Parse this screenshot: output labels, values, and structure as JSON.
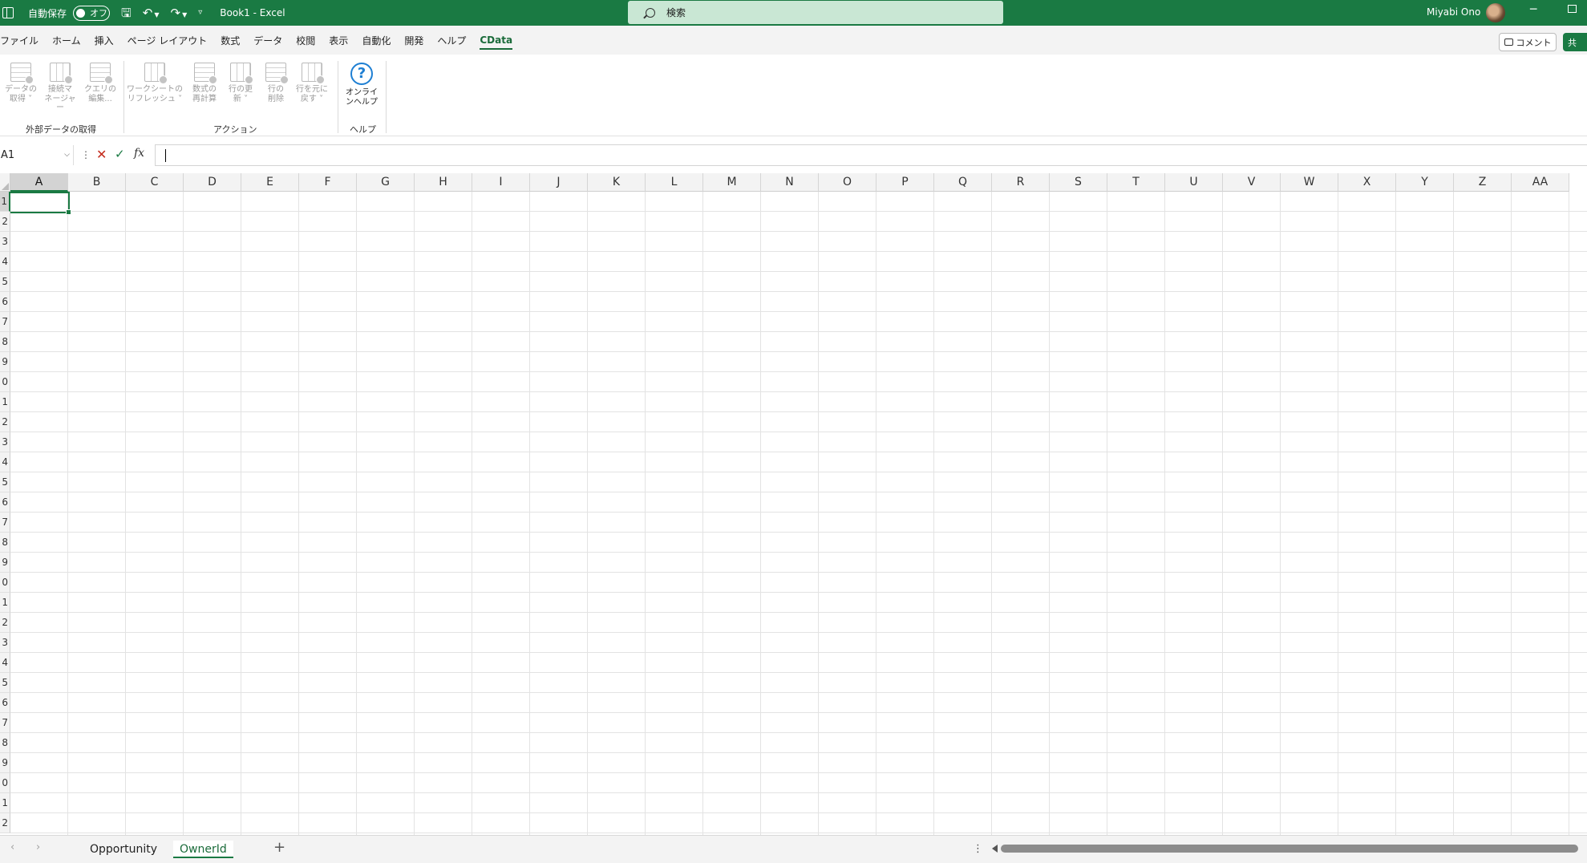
{
  "titlebar": {
    "autosave_label": "自動保存",
    "autosave_state": "オフ",
    "doc_title": "Book1  -  Excel",
    "search_placeholder": "検索",
    "user_name": "Miyabi Ono",
    "accent_color": "#1a7a43"
  },
  "menu": {
    "tabs": [
      "ファイル",
      "ホーム",
      "挿入",
      "ページ レイアウト",
      "数式",
      "データ",
      "校閲",
      "表示",
      "自動化",
      "開発",
      "ヘルプ",
      "CData"
    ],
    "active_tab": "CData",
    "comment_label": "コメント",
    "share_label": "共"
  },
  "ribbon": {
    "buttons": [
      {
        "line1": "データの",
        "line2": "取得 ˅",
        "icon": "get-data-icon"
      },
      {
        "line1": "接続マ",
        "line2": "ネージャー",
        "icon": "connection-manager-icon"
      },
      {
        "line1": "クエリの",
        "line2": "編集...",
        "icon": "edit-query-icon"
      },
      {
        "line1": "ワークシートの",
        "line2": "リフレッシュ ˅",
        "icon": "refresh-worksheet-icon"
      },
      {
        "line1": "数式の",
        "line2": "再計算",
        "icon": "recalculate-icon"
      },
      {
        "line1": "行の更",
        "line2": "新 ˅",
        "icon": "update-rows-icon"
      },
      {
        "line1": "行の",
        "line2": "削除",
        "icon": "delete-rows-icon"
      },
      {
        "line1": "行を元に",
        "line2": "戻す ˅",
        "icon": "revert-rows-icon"
      },
      {
        "line1": "オンライ",
        "line2": "ンヘルプ",
        "icon": "help-icon"
      }
    ],
    "groups": [
      "外部データの取得",
      "アクション",
      "ヘルプ"
    ]
  },
  "formula_bar": {
    "name_box": "A1",
    "fx_label": "fx",
    "formula": ""
  },
  "grid": {
    "columns": [
      "A",
      "B",
      "C",
      "D",
      "E",
      "F",
      "G",
      "H",
      "I",
      "J",
      "K",
      "L",
      "M",
      "N",
      "O",
      "P",
      "Q",
      "R",
      "S",
      "T",
      "U",
      "V",
      "W",
      "X",
      "Y",
      "Z",
      "AA"
    ],
    "row_labels": [
      "1",
      "2",
      "3",
      "4",
      "5",
      "6",
      "7",
      "8",
      "9",
      "0",
      "1",
      "2",
      "3",
      "4",
      "5",
      "6",
      "7",
      "8",
      "9",
      "0",
      "1",
      "2",
      "3",
      "4",
      "5",
      "6",
      "7",
      "8",
      "9",
      "0",
      "1",
      "2"
    ],
    "selected_cell": "A1"
  },
  "sheets": {
    "tabs": [
      "Opportunity",
      "OwnerId"
    ],
    "active": "OwnerId",
    "add_label": "+"
  }
}
